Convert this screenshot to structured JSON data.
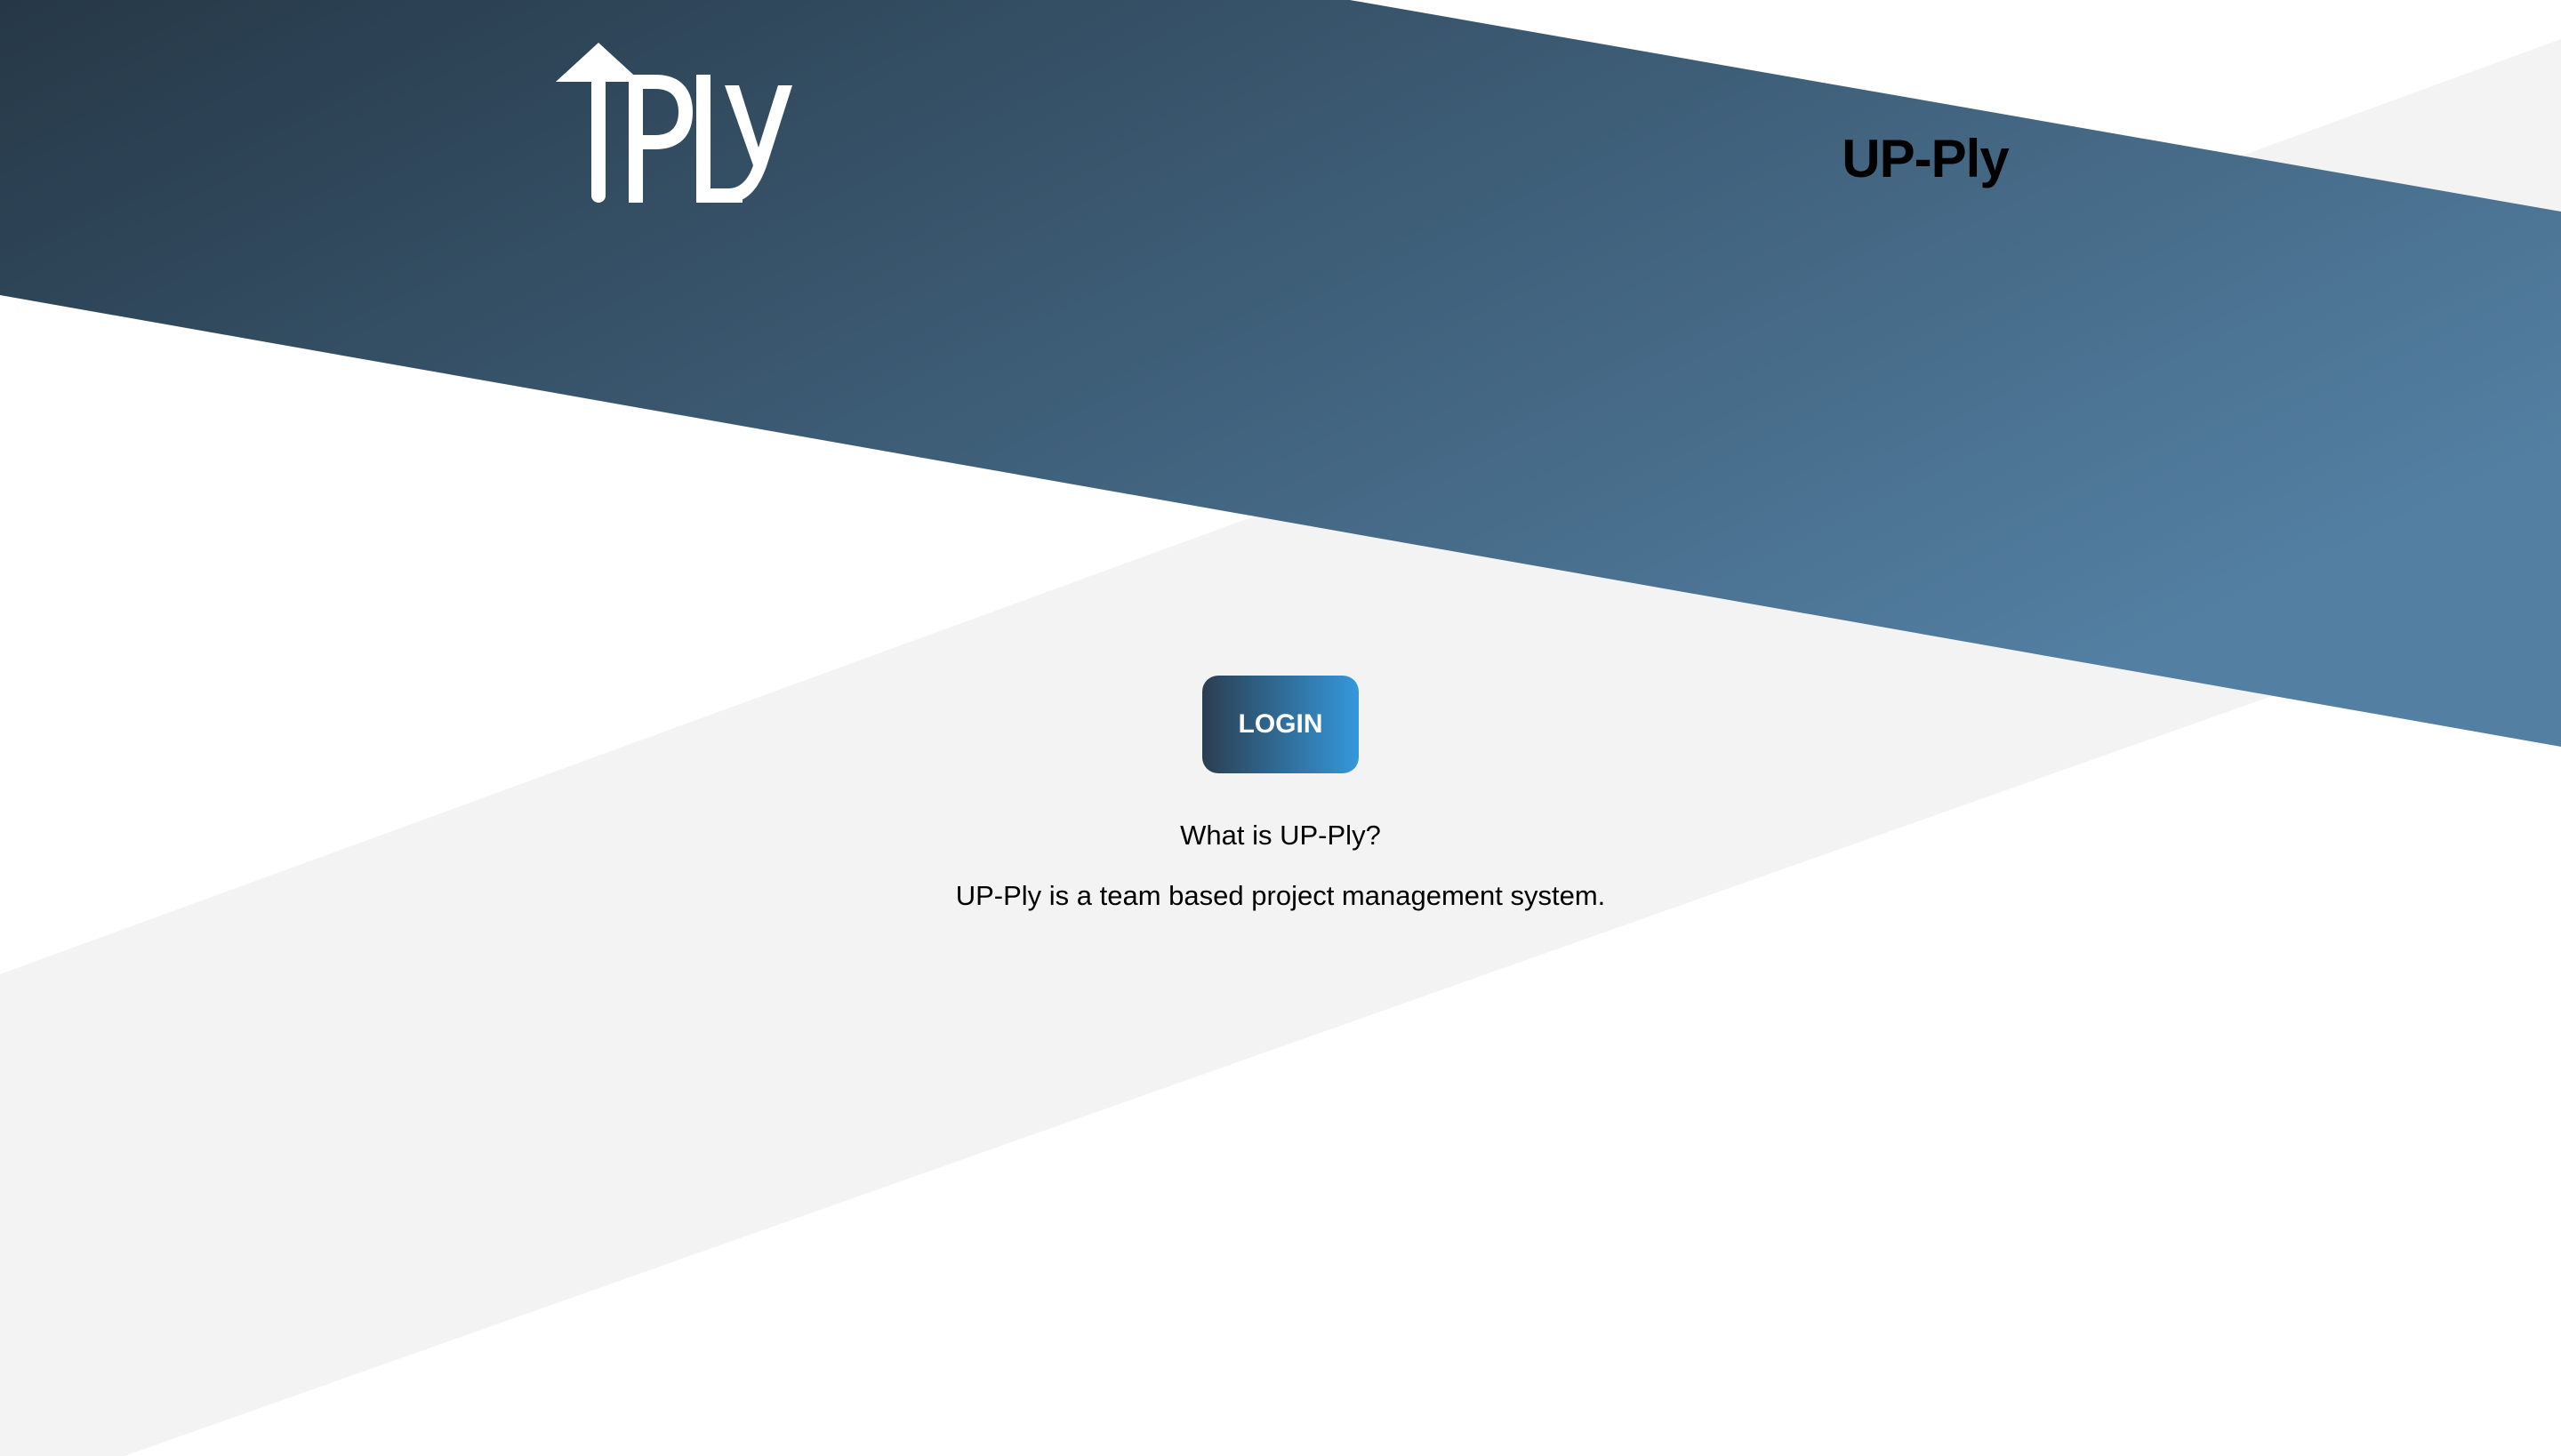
{
  "header": {
    "logo_text": "UPLY",
    "title": "UP-Ply"
  },
  "main": {
    "login_label": "LOGIN",
    "about_heading": "What is UP-Ply?",
    "about_text": "UP-Ply is a team based project management system."
  },
  "colors": {
    "band_dark": "#263847",
    "band_light": "#537fa2",
    "grey_stripe": "#f3f3f3",
    "button_start": "#2c3e50",
    "button_end": "#3498db"
  },
  "icons": {
    "logo": "up-arrow-ply-logo"
  }
}
